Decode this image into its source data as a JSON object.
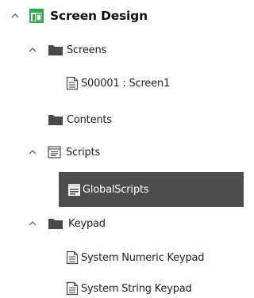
{
  "tree": {
    "root": {
      "label": "Screen Design",
      "icon": "screen-design-icon",
      "expanded": true,
      "accent": "#2eaa4a"
    },
    "screens": {
      "label": "Screens",
      "icon": "folder-icon",
      "expanded": true,
      "items": [
        {
          "label": "S00001 : Screen1",
          "icon": "screen-page-icon"
        }
      ]
    },
    "contents": {
      "label": "Contents",
      "icon": "folder-icon"
    },
    "scripts": {
      "label": "Scripts",
      "icon": "scripts-icon",
      "expanded": true,
      "items": [
        {
          "label": "GlobalScripts",
          "icon": "global-script-icon",
          "selected": true
        }
      ]
    },
    "keypad": {
      "label": "Keypad",
      "icon": "folder-icon",
      "expanded": true,
      "items": [
        {
          "label": "System Numeric Keypad",
          "icon": "keypad-page-icon"
        },
        {
          "label": "System String Keypad",
          "icon": "keypad-page-icon"
        }
      ]
    }
  },
  "colors": {
    "folder": "#4a4a4a",
    "selection_bg": "#4d4d4d",
    "selection_text": "#ffffff",
    "chevron": "#6b6b6b"
  }
}
